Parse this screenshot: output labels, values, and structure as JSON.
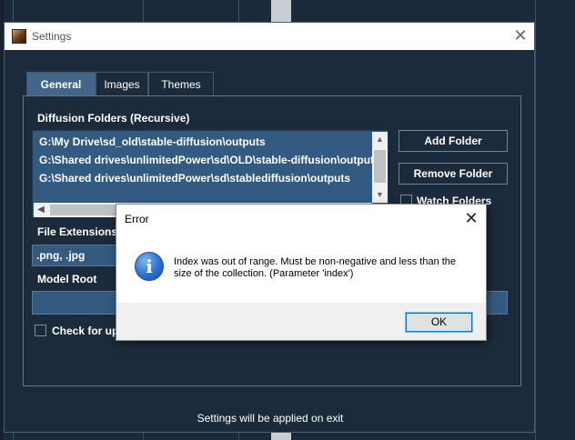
{
  "settings_window": {
    "title": "Settings",
    "close_glyph": "✕",
    "icon": "app-icon"
  },
  "tabs": [
    {
      "label": "General",
      "active": true
    },
    {
      "label": "Images",
      "active": false
    },
    {
      "label": "Themes",
      "active": false
    }
  ],
  "general": {
    "diffusion_folders_label": "Diffusion Folders (Recursive)",
    "folders": [
      "G:\\My Drive\\sd_old\\stable-diffusion\\outputs",
      "G:\\Shared drives\\unlimitedPower\\sd\\OLD\\stable-diffusion\\outputs",
      "G:\\Shared drives\\unlimitedPower\\sd\\stablediffusion\\outputs"
    ],
    "add_folder_label": "Add Folder",
    "remove_folder_label": "Remove Folder",
    "watch_folders_label": "Watch Folders",
    "watch_folders_checked": false,
    "file_extensions_label": "File Extensions",
    "file_extensions_value": ".png, .jpg",
    "model_root_label": "Model Root",
    "model_root_value": "",
    "check_updates_label": "Check for up",
    "check_updates_checked": false
  },
  "footer_text": "Settings will be applied on exit",
  "error_dialog": {
    "title": "Error",
    "close_glyph": "✕",
    "icon": "info-icon",
    "message": "Index was out of range. Must be non-negative and less than the size of the collection. (Parameter 'index')",
    "ok_label": "OK"
  },
  "colors": {
    "background": "#1b2a3a",
    "accent": "#41668a",
    "list_bg": "#335b81"
  }
}
